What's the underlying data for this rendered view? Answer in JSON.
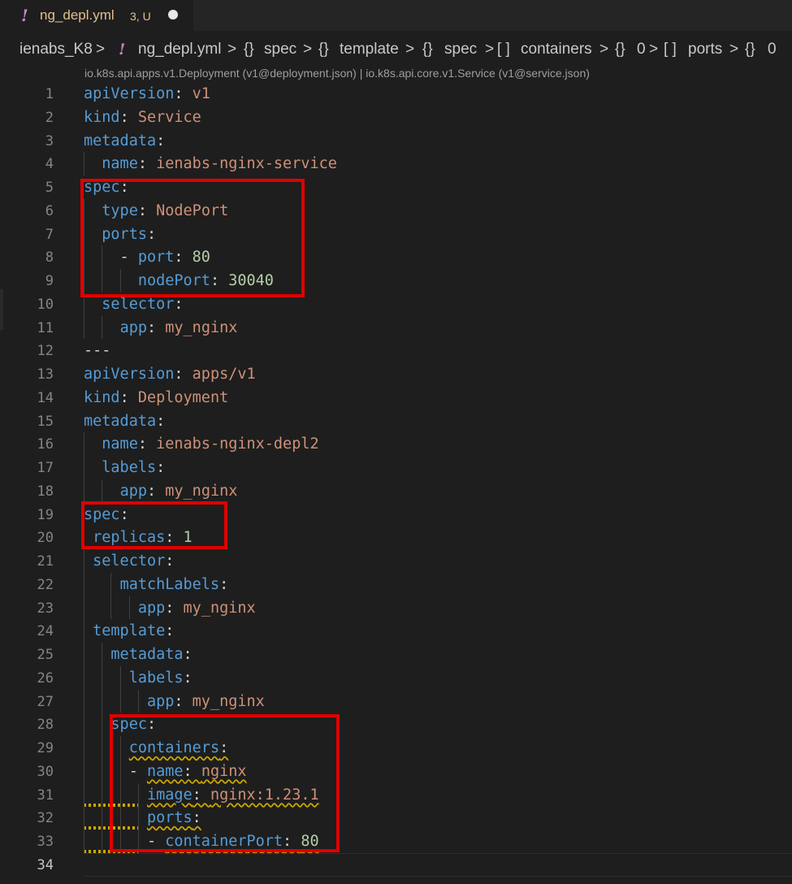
{
  "tab": {
    "icon": "!",
    "filename": "ng_depl.yml",
    "status": "3, U",
    "modified_icon": "unsaved-dot-icon"
  },
  "breadcrumb": {
    "items": [
      "ienabs_K8",
      ">",
      "!",
      "ng_depl.yml",
      ">",
      "{}",
      "spec",
      ">",
      "{}",
      "template",
      ">",
      "{}",
      "spec",
      ">",
      "[ ]",
      "containers",
      ">",
      "{}",
      "0",
      ">",
      "[ ]",
      "ports",
      ">",
      "{}",
      "0"
    ]
  },
  "schema_hint": "io.k8s.api.apps.v1.Deployment (v1@deployment.json) | io.k8s.api.core.v1.Service (v1@service.json)",
  "lines": [
    {
      "n": "1",
      "t": [
        [
          "k",
          "apiVersion"
        ],
        [
          "p",
          ": "
        ],
        [
          "s",
          "v1"
        ]
      ]
    },
    {
      "n": "2",
      "t": [
        [
          "k",
          "kind"
        ],
        [
          "p",
          ": "
        ],
        [
          "s",
          "Service"
        ]
      ]
    },
    {
      "n": "3",
      "t": [
        [
          "k",
          "metadata"
        ],
        [
          "p",
          ":"
        ]
      ]
    },
    {
      "n": "4",
      "t": [
        [
          "p",
          "  "
        ],
        [
          "k",
          "name"
        ],
        [
          "p",
          ": "
        ],
        [
          "s",
          "ienabs-nginx-service"
        ]
      ]
    },
    {
      "n": "5",
      "t": [
        [
          "k",
          "spec"
        ],
        [
          "p",
          ":"
        ]
      ]
    },
    {
      "n": "6",
      "t": [
        [
          "p",
          "  "
        ],
        [
          "k",
          "type"
        ],
        [
          "p",
          ": "
        ],
        [
          "s",
          "NodePort"
        ]
      ]
    },
    {
      "n": "7",
      "t": [
        [
          "p",
          "  "
        ],
        [
          "k",
          "ports"
        ],
        [
          "p",
          ":"
        ]
      ]
    },
    {
      "n": "8",
      "t": [
        [
          "p",
          "    - "
        ],
        [
          "k",
          "port"
        ],
        [
          "p",
          ": "
        ],
        [
          "n",
          "80"
        ]
      ]
    },
    {
      "n": "9",
      "t": [
        [
          "p",
          "      "
        ],
        [
          "k",
          "nodePort"
        ],
        [
          "p",
          ": "
        ],
        [
          "n",
          "30040"
        ]
      ]
    },
    {
      "n": "10",
      "t": [
        [
          "p",
          "  "
        ],
        [
          "k",
          "selector"
        ],
        [
          "p",
          ":"
        ]
      ]
    },
    {
      "n": "11",
      "t": [
        [
          "p",
          "    "
        ],
        [
          "k",
          "app"
        ],
        [
          "p",
          ": "
        ],
        [
          "s",
          "my_nginx"
        ]
      ]
    },
    {
      "n": "12",
      "t": [
        [
          "p",
          "---"
        ]
      ]
    },
    {
      "n": "13",
      "t": [
        [
          "k",
          "apiVersion"
        ],
        [
          "p",
          ": "
        ],
        [
          "s",
          "apps/v1"
        ]
      ]
    },
    {
      "n": "14",
      "t": [
        [
          "k",
          "kind"
        ],
        [
          "p",
          ": "
        ],
        [
          "s",
          "Deployment"
        ]
      ]
    },
    {
      "n": "15",
      "t": [
        [
          "k",
          "metadata"
        ],
        [
          "p",
          ":"
        ]
      ]
    },
    {
      "n": "16",
      "t": [
        [
          "p",
          "  "
        ],
        [
          "k",
          "name"
        ],
        [
          "p",
          ": "
        ],
        [
          "s",
          "ienabs-nginx-depl2"
        ]
      ]
    },
    {
      "n": "17",
      "t": [
        [
          "p",
          "  "
        ],
        [
          "k",
          "labels"
        ],
        [
          "p",
          ":"
        ]
      ]
    },
    {
      "n": "18",
      "t": [
        [
          "p",
          "    "
        ],
        [
          "k",
          "app"
        ],
        [
          "p",
          ": "
        ],
        [
          "s",
          "my_nginx"
        ]
      ]
    },
    {
      "n": "19",
      "t": [
        [
          "k",
          "spec"
        ],
        [
          "p",
          ":"
        ]
      ]
    },
    {
      "n": "20",
      "t": [
        [
          "p",
          " "
        ],
        [
          "k",
          "replicas"
        ],
        [
          "p",
          ": "
        ],
        [
          "n",
          "1"
        ]
      ]
    },
    {
      "n": "21",
      "t": [
        [
          "p",
          " "
        ],
        [
          "k",
          "selector"
        ],
        [
          "p",
          ":"
        ]
      ]
    },
    {
      "n": "22",
      "t": [
        [
          "p",
          "    "
        ],
        [
          "k",
          "matchLabels"
        ],
        [
          "p",
          ":"
        ]
      ]
    },
    {
      "n": "23",
      "t": [
        [
          "p",
          "      "
        ],
        [
          "k",
          "app"
        ],
        [
          "p",
          ": "
        ],
        [
          "s",
          "my_nginx"
        ]
      ]
    },
    {
      "n": "24",
      "t": [
        [
          "p",
          " "
        ],
        [
          "k",
          "template"
        ],
        [
          "p",
          ":"
        ]
      ]
    },
    {
      "n": "25",
      "t": [
        [
          "p",
          "   "
        ],
        [
          "k",
          "metadata"
        ],
        [
          "p",
          ":"
        ]
      ]
    },
    {
      "n": "26",
      "t": [
        [
          "p",
          "     "
        ],
        [
          "k",
          "labels"
        ],
        [
          "p",
          ":"
        ]
      ]
    },
    {
      "n": "27",
      "t": [
        [
          "p",
          "       "
        ],
        [
          "k",
          "app"
        ],
        [
          "p",
          ": "
        ],
        [
          "s",
          "my_nginx"
        ]
      ]
    },
    {
      "n": "28",
      "t": [
        [
          "p",
          "   "
        ],
        [
          "k",
          "spec"
        ],
        [
          "p",
          ":"
        ]
      ]
    },
    {
      "n": "29",
      "t": [
        [
          "p",
          "     "
        ],
        [
          "k",
          "containers"
        ],
        [
          "p",
          ":"
        ]
      ],
      "squig": [
        1,
        2
      ]
    },
    {
      "n": "30",
      "t": [
        [
          "p",
          "     - "
        ],
        [
          "k",
          "name"
        ],
        [
          "p",
          ": "
        ],
        [
          "s",
          "nginx"
        ]
      ],
      "squig": [
        1,
        3
      ]
    },
    {
      "n": "31",
      "t": [
        [
          "p",
          "       "
        ],
        [
          "k",
          "image"
        ],
        [
          "p",
          ": "
        ],
        [
          "s",
          "nginx:1.23.1"
        ]
      ],
      "squig": [
        1,
        3
      ],
      "lead": true
    },
    {
      "n": "32",
      "t": [
        [
          "p",
          "       "
        ],
        [
          "k",
          "ports"
        ],
        [
          "p",
          ":"
        ]
      ],
      "squig": [
        1,
        2
      ],
      "lead": true
    },
    {
      "n": "33",
      "t": [
        [
          "p",
          "       - "
        ],
        [
          "k",
          "containerPort"
        ],
        [
          "p",
          ": "
        ],
        [
          "n",
          "80"
        ]
      ],
      "squig": [
        1,
        3
      ],
      "lead": true
    },
    {
      "n": "34",
      "t": [],
      "active": true
    }
  ]
}
